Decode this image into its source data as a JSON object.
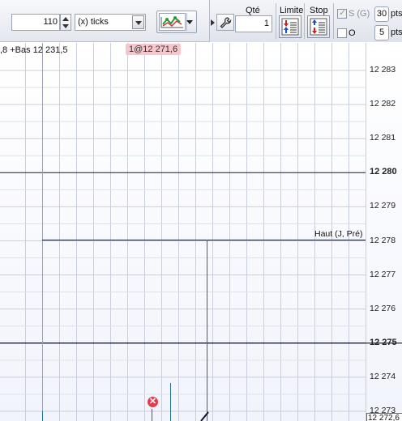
{
  "toolbar": {
    "ticks_value": "110",
    "unit_selected": "(x) ticks",
    "indicator_icon": "chart-indicator-icon"
  },
  "order": {
    "qty_label": "Qté",
    "qty_value": "1",
    "limit_label": "Limite",
    "stop_label": "Stop",
    "sg_label": "S (G)",
    "sg_checked": true,
    "o_label": "O",
    "o_checked": false,
    "pts_top_value": "30",
    "pts_bottom_value": "5",
    "pts_label": "pts"
  },
  "chart": {
    "info_text": ",8 +Bas 12 231,5",
    "trade_badge": "1@12 271,6",
    "haut_label": "Haut (J, Pré)",
    "current_price": "12 272,6",
    "price_labels": [
      {
        "text": "12 283",
        "bold": false
      },
      {
        "text": "12 282",
        "bold": false
      },
      {
        "text": "12 281",
        "bold": false
      },
      {
        "text": "12 280",
        "bold": true
      },
      {
        "text": "12 279",
        "bold": false
      },
      {
        "text": "12 278",
        "bold": false
      },
      {
        "text": "12 277",
        "bold": false
      },
      {
        "text": "12 276",
        "bold": false
      },
      {
        "text": "12 275",
        "bold": true
      },
      {
        "text": "12 274",
        "bold": false
      },
      {
        "text": "12 273",
        "bold": false
      }
    ],
    "colors": {
      "grid": "#c9cedc",
      "strong_line": "#0d1633",
      "candle": "#1f6f86",
      "badge_bg": "#f5c6cc",
      "marker": "#e33c4e"
    }
  }
}
